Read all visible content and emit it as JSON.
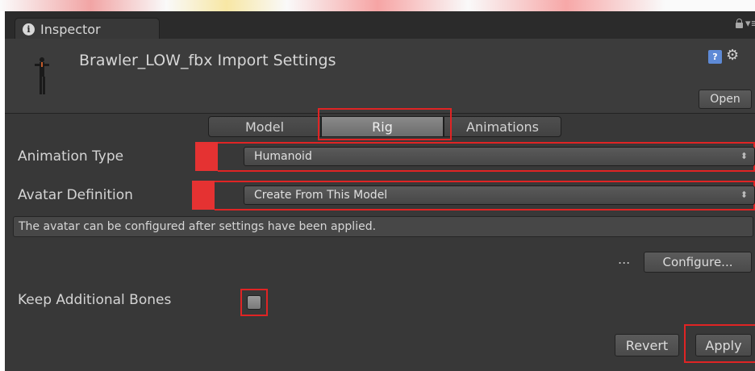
{
  "window": {
    "tab_title": "Inspector"
  },
  "header": {
    "title": "Brawler_LOW_fbx Import Settings",
    "open_label": "Open"
  },
  "tabs": [
    {
      "label": "Model",
      "selected": false
    },
    {
      "label": "Rig",
      "selected": true
    },
    {
      "label": "Animations",
      "selected": false
    }
  ],
  "rig": {
    "animation_type": {
      "label": "Animation Type",
      "value": "Humanoid"
    },
    "avatar_definition": {
      "label": "Avatar Definition",
      "value": "Create From This Model"
    },
    "info_message": "The avatar can be configured after settings have been applied.",
    "ellipsis": "...",
    "configure_label": "Configure...",
    "keep_bones": {
      "label": "Keep Additional Bones",
      "checked": false
    }
  },
  "footer": {
    "revert_label": "Revert",
    "apply_label": "Apply"
  },
  "colors": {
    "panel": "#383838",
    "highlight": "#e02424",
    "selected_tab": "#7a7a7a"
  },
  "icons": [
    "info-icon",
    "lock-icon",
    "menu-icon",
    "model-preview-icon",
    "help-icon",
    "gear-icon",
    "popup-arrow-icon"
  ]
}
